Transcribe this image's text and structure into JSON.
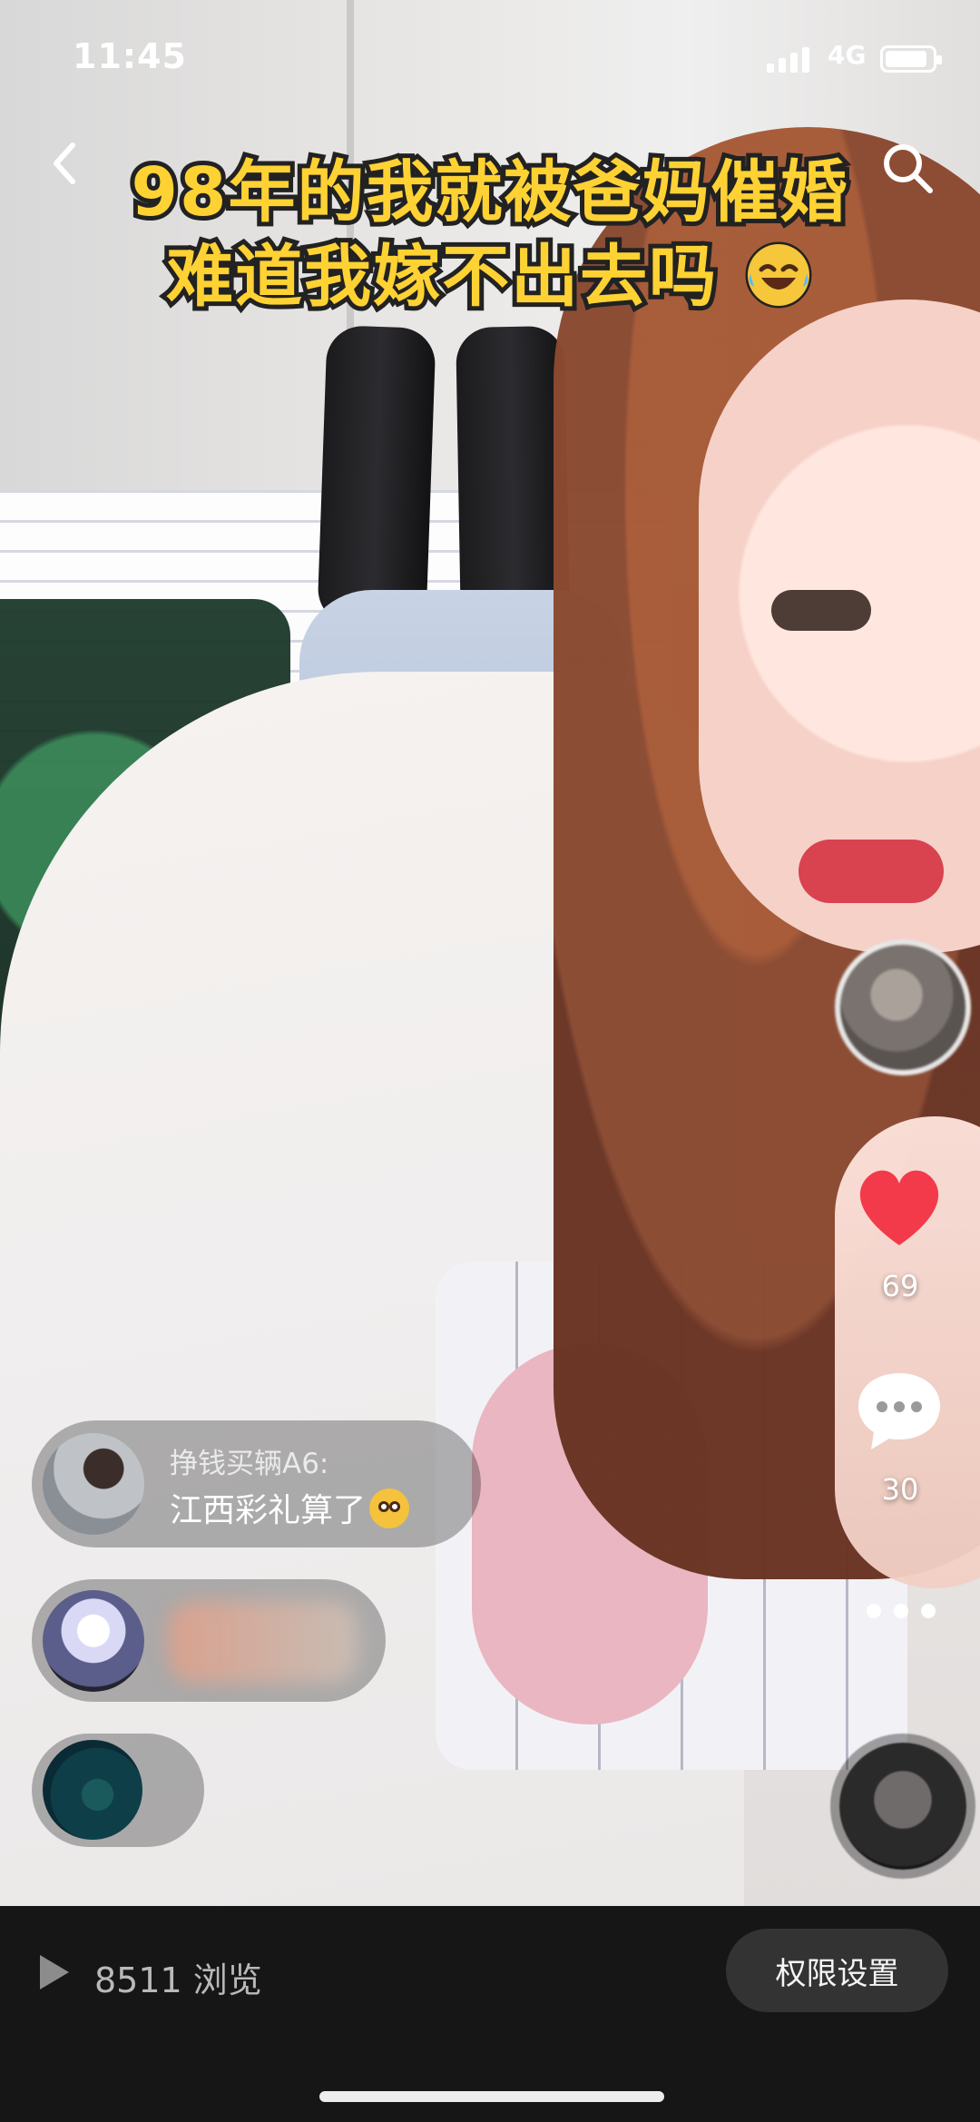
{
  "status_bar": {
    "time": "11:45",
    "network": "4G",
    "battery_level": 0.9
  },
  "overlay_title": {
    "line1": "98年的我就被爸妈催婚",
    "line2": "难道我嫁不出去吗"
  },
  "actions": {
    "like_count": "69",
    "comment_count": "30"
  },
  "comments": [
    {
      "username": "挣钱买辆A6:",
      "text": "江西彩礼算了"
    }
  ],
  "bottom_bar": {
    "views_text": "8511 浏览",
    "permission_button": "权限设置"
  },
  "icons": {
    "back": "chevron-left-icon",
    "search": "search-icon",
    "like": "heart-icon",
    "comment": "comment-icon",
    "more": "more-icon",
    "play": "play-icon"
  },
  "colors": {
    "title_yellow": "#ffd234",
    "like_red": "#f23a4b",
    "bottom_bar": "#161616"
  }
}
